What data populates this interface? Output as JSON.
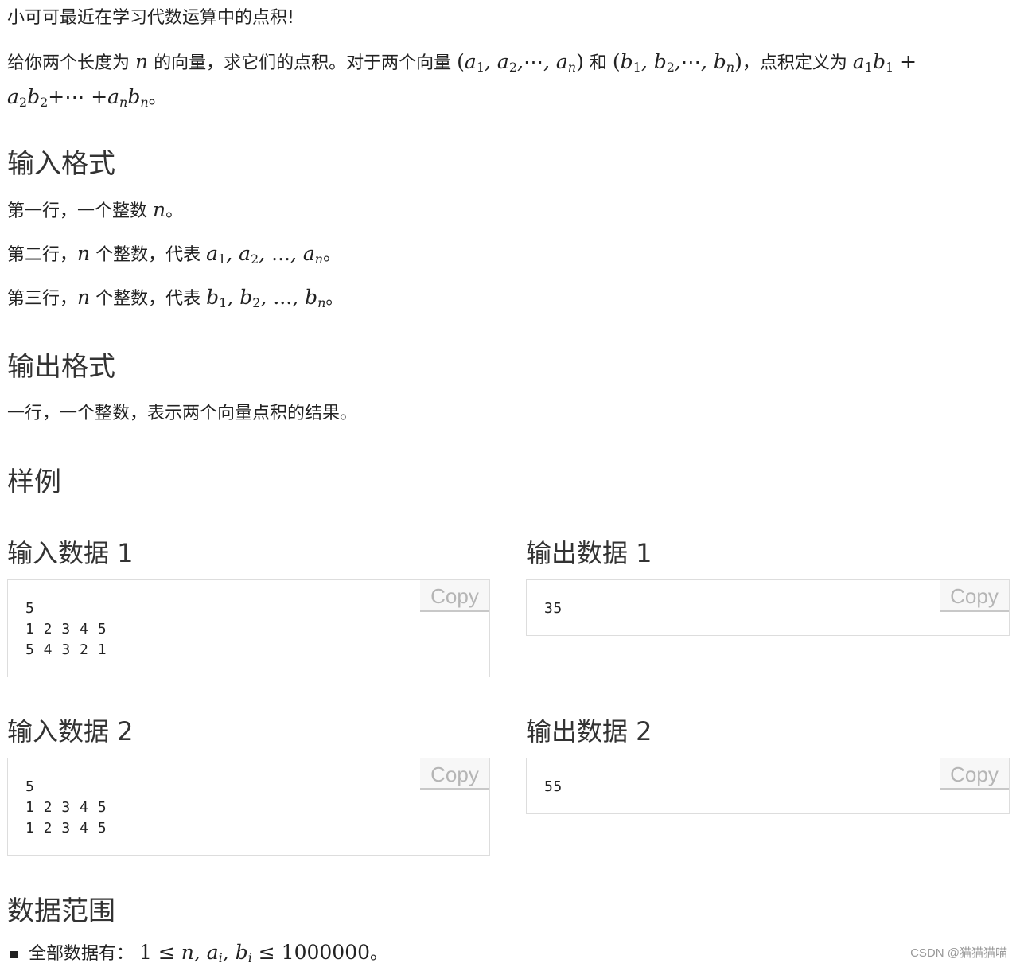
{
  "intro": {
    "line1": "小可可最近在学习代数运算中的点积!",
    "desc_a": "给你两个长度为",
    "desc_n": "n",
    "desc_b": "的向量，求它们的点积。对于两个向量",
    "vec_a": "(a",
    "vec_mid": "和",
    "desc_c": "，点积定义为",
    "desc_end": "。"
  },
  "input_format": {
    "title": "输入格式",
    "line1_text": "第一行，一个整数",
    "line2_text": "第二行，",
    "line2_mid": "个整数，代表",
    "line3_text": "第三行，",
    "line3_mid": "个整数，代表",
    "period": "。"
  },
  "output_format": {
    "title": "输出格式",
    "line1": "一行，一个整数，表示两个向量点积的结果。"
  },
  "samples": {
    "title": "样例",
    "copy_label": "Copy",
    "items": [
      {
        "input_title": "输入数据 1",
        "input": "5\n1 2 3 4 5\n5 4 3 2 1",
        "output_title": "输出数据 1",
        "output": "35"
      },
      {
        "input_title": "输入数据 2",
        "input": "5\n1 2 3 4 5\n1 2 3 4 5",
        "output_title": "输出数据 2",
        "output": "55"
      }
    ]
  },
  "data_range": {
    "title": "数据范围",
    "item_text": "全部数据有：",
    "constraint_upper": "1000000",
    "period": "。"
  },
  "watermark": "CSDN @猫猫猫喵"
}
